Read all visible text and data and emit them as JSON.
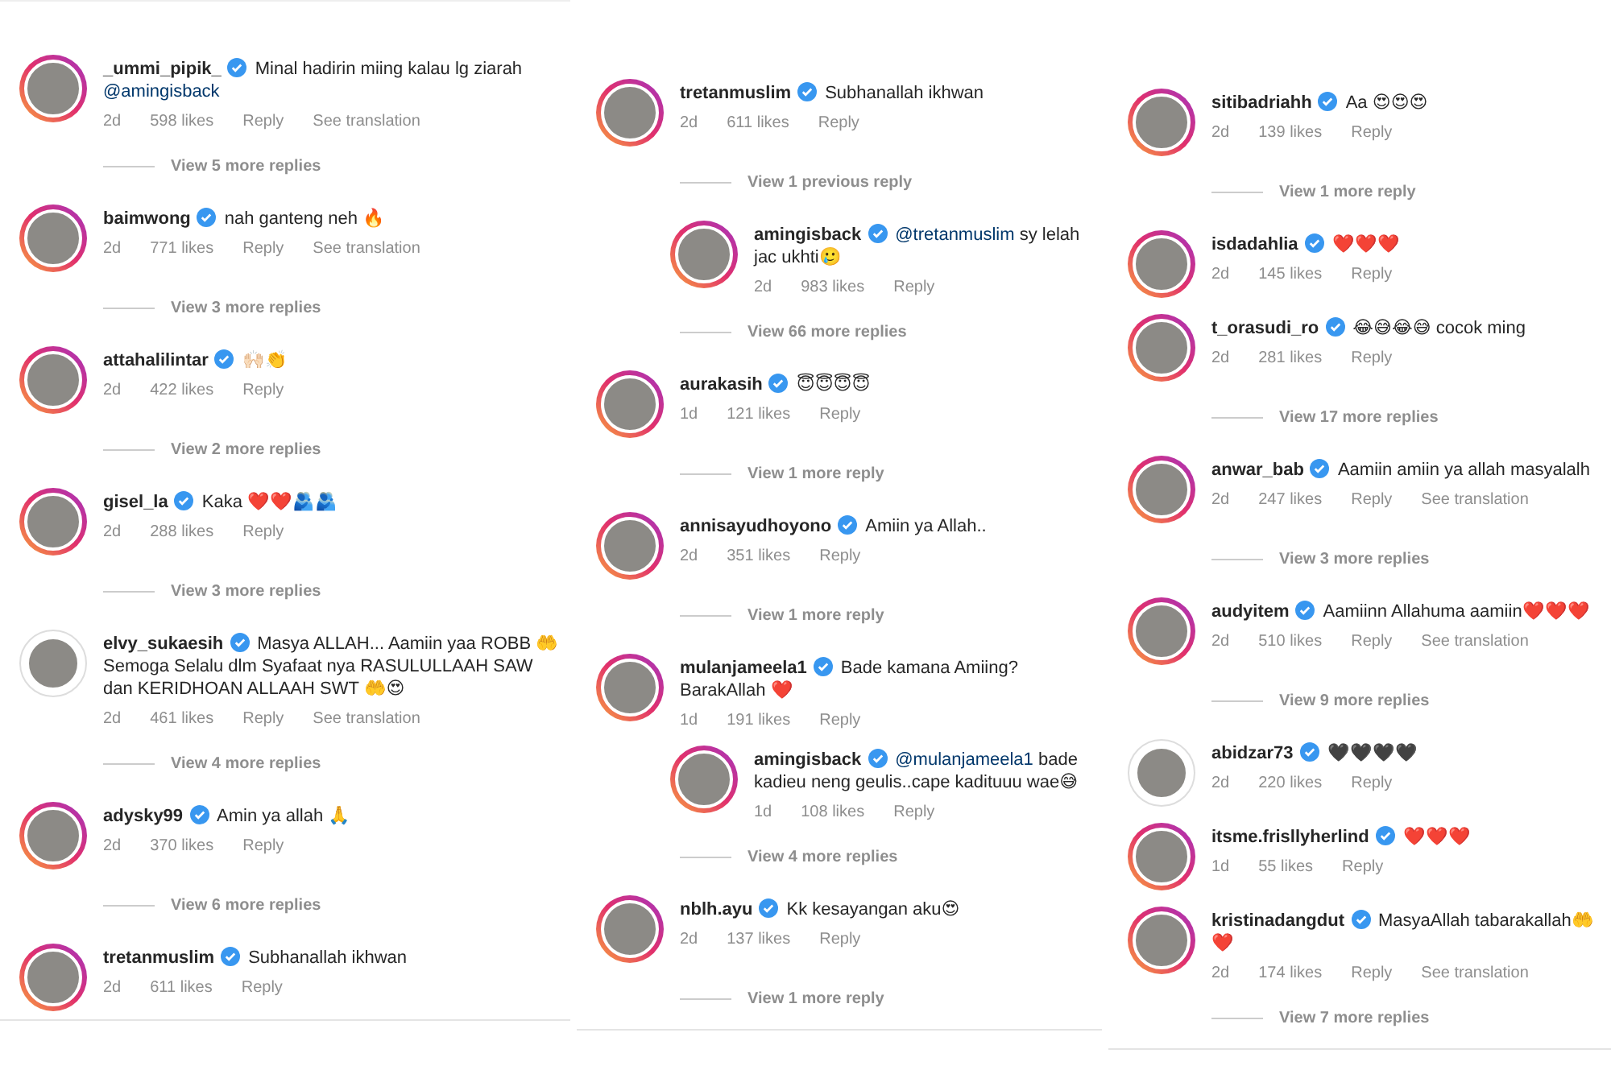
{
  "columns": [
    {
      "items": [
        {
          "kind": "comment",
          "username": "_ummi_pipik_",
          "verified": true,
          "story_ring": true,
          "parts": [
            {
              "kind": "text",
              "s": "Minal hadirin miing kalau lg ziarah "
            },
            {
              "kind": "mention",
              "s": "@amingisback"
            }
          ],
          "time": "2d",
          "likes": "598 likes",
          "reply": "Reply",
          "translation": "See translation"
        },
        {
          "kind": "view_replies",
          "label": "View 5 more replies"
        },
        {
          "kind": "comment",
          "username": "baimwong",
          "verified": true,
          "story_ring": true,
          "parts": [
            {
              "kind": "text",
              "s": "nah ganteng neh 🔥"
            }
          ],
          "time": "2d",
          "likes": "771 likes",
          "reply": "Reply",
          "translation": "See translation"
        },
        {
          "kind": "view_replies",
          "label": "View 3 more replies"
        },
        {
          "kind": "comment",
          "username": "attahalilintar",
          "verified": true,
          "story_ring": true,
          "parts": [
            {
              "kind": "text",
              "s": "🙌🏻👏"
            }
          ],
          "time": "2d",
          "likes": "422 likes",
          "reply": "Reply"
        },
        {
          "kind": "view_replies",
          "label": "View 2 more replies"
        },
        {
          "kind": "comment",
          "username": "gisel_la",
          "verified": true,
          "story_ring": true,
          "parts": [
            {
              "kind": "text",
              "s": "Kaka ❤️❤️🫂🫂"
            }
          ],
          "time": "2d",
          "likes": "288 likes",
          "reply": "Reply"
        },
        {
          "kind": "view_replies",
          "label": "View 3 more replies"
        },
        {
          "kind": "comment",
          "username": "elvy_sukaesih",
          "verified": true,
          "story_ring": false,
          "parts": [
            {
              "kind": "text",
              "s": "Masya ALLAH... Aamiin yaa ROBB 🤲 Semoga Selalu dlm Syafaat nya RASULULLAAH SAW dan KERIDHOAN ALLAAH SWT 🤲😍"
            }
          ],
          "time": "2d",
          "likes": "461 likes",
          "reply": "Reply",
          "translation": "See translation"
        },
        {
          "kind": "view_replies",
          "label": "View 4 more replies"
        },
        {
          "kind": "comment",
          "username": "adysky99",
          "verified": true,
          "story_ring": true,
          "parts": [
            {
              "kind": "text",
              "s": "Amin ya allah 🙏"
            }
          ],
          "time": "2d",
          "likes": "370 likes",
          "reply": "Reply"
        },
        {
          "kind": "view_replies",
          "label": "View 6 more replies"
        },
        {
          "kind": "comment",
          "username": "tretanmuslim",
          "verified": true,
          "story_ring": true,
          "parts": [
            {
              "kind": "text",
              "s": "Subhanallah ikhwan"
            }
          ],
          "time": "2d",
          "likes": "611 likes",
          "reply": "Reply"
        }
      ]
    },
    {
      "items": [
        {
          "kind": "comment",
          "username": "tretanmuslim",
          "verified": true,
          "story_ring": true,
          "parts": [
            {
              "kind": "text",
              "s": "Subhanallah ikhwan"
            }
          ],
          "time": "2d",
          "likes": "611 likes",
          "reply": "Reply",
          "children": [
            {
              "kind": "view_replies",
              "label": "View 1 previous reply"
            },
            {
              "kind": "comment",
              "username": "amingisback",
              "verified": true,
              "story_ring": true,
              "parts": [
                {
                  "kind": "mention",
                  "s": "@tretanmuslim"
                },
                {
                  "kind": "text",
                  "s": " sy lelah jac ukhti🥲"
                }
              ],
              "time": "2d",
              "likes": "983 likes",
              "reply": "Reply"
            }
          ]
        },
        {
          "kind": "view_replies",
          "label": "View 66 more replies"
        },
        {
          "kind": "comment",
          "username": "aurakasih",
          "verified": true,
          "story_ring": true,
          "parts": [
            {
              "kind": "text",
              "s": "😇😇😇😇"
            }
          ],
          "time": "1d",
          "likes": "121 likes",
          "reply": "Reply"
        },
        {
          "kind": "view_replies",
          "label": "View 1 more reply"
        },
        {
          "kind": "comment",
          "username": "annisayudhoyono",
          "verified": true,
          "story_ring": true,
          "parts": [
            {
              "kind": "text",
              "s": "Amiin ya Allah.."
            }
          ],
          "time": "2d",
          "likes": "351 likes",
          "reply": "Reply"
        },
        {
          "kind": "view_replies",
          "label": "View 1 more reply"
        },
        {
          "kind": "comment",
          "username": "mulanjameela1",
          "verified": true,
          "story_ring": true,
          "parts": [
            {
              "kind": "text",
              "s": "Bade kamana Amiing? BarakAllah ❤️"
            }
          ],
          "time": "1d",
          "likes": "191 likes",
          "reply": "Reply",
          "children": [
            {
              "kind": "comment",
              "username": "amingisback",
              "verified": true,
              "story_ring": true,
              "parts": [
                {
                  "kind": "mention",
                  "s": "@mulanjameela1"
                },
                {
                  "kind": "text",
                  "s": " bade kadieu neng geulis..cape kadituuu wae😅"
                }
              ],
              "time": "1d",
              "likes": "108 likes",
              "reply": "Reply"
            }
          ]
        },
        {
          "kind": "view_replies",
          "label": "View 4 more replies"
        },
        {
          "kind": "comment",
          "username": "nblh.ayu",
          "verified": true,
          "story_ring": true,
          "parts": [
            {
              "kind": "text",
              "s": "Kk kesayangan aku😍"
            }
          ],
          "time": "2d",
          "likes": "137 likes",
          "reply": "Reply"
        },
        {
          "kind": "view_replies",
          "label": "View 1 more reply"
        }
      ]
    },
    {
      "items": [
        {
          "kind": "comment",
          "username": "sitibadriahh",
          "verified": true,
          "story_ring": true,
          "parts": [
            {
              "kind": "text",
              "s": "Aa 😍😍😍"
            }
          ],
          "time": "2d",
          "likes": "139 likes",
          "reply": "Reply"
        },
        {
          "kind": "view_replies",
          "label": "View 1 more reply"
        },
        {
          "kind": "comment",
          "username": "isdadahlia",
          "verified": true,
          "story_ring": true,
          "parts": [
            {
              "kind": "text",
              "s": "❤️❤️❤️"
            }
          ],
          "time": "2d",
          "likes": "145 likes",
          "reply": "Reply"
        },
        {
          "kind": "comment",
          "username": "t_orasudi_ro",
          "verified": true,
          "story_ring": true,
          "parts": [
            {
              "kind": "text",
              "s": "😂😅😂😅 cocok ming"
            }
          ],
          "time": "2d",
          "likes": "281 likes",
          "reply": "Reply"
        },
        {
          "kind": "view_replies",
          "label": "View 17 more replies"
        },
        {
          "kind": "comment",
          "username": "anwar_bab",
          "verified": true,
          "story_ring": true,
          "parts": [
            {
              "kind": "text",
              "s": "Aamiin amiin ya allah masyalalh"
            }
          ],
          "time": "2d",
          "likes": "247 likes",
          "reply": "Reply",
          "translation": "See translation"
        },
        {
          "kind": "view_replies",
          "label": "View 3 more replies"
        },
        {
          "kind": "comment",
          "username": "audyitem",
          "verified": true,
          "story_ring": true,
          "parts": [
            {
              "kind": "text",
              "s": "Aamiinn Allahuma aamiin❤️❤️❤️"
            }
          ],
          "time": "2d",
          "likes": "510 likes",
          "reply": "Reply",
          "translation": "See translation"
        },
        {
          "kind": "view_replies",
          "label": "View 9 more replies"
        },
        {
          "kind": "comment",
          "username": "abidzar73",
          "verified": true,
          "story_ring": false,
          "parts": [
            {
              "kind": "text",
              "s": "🖤🖤🖤🖤"
            }
          ],
          "time": "2d",
          "likes": "220 likes",
          "reply": "Reply"
        },
        {
          "kind": "comment",
          "username": "itsme.frisllyherlind",
          "verified": true,
          "story_ring": true,
          "parts": [
            {
              "kind": "text",
              "s": "❤️❤️❤️"
            }
          ],
          "time": "1d",
          "likes": "55 likes",
          "reply": "Reply"
        },
        {
          "kind": "comment",
          "username": "kristinadangdut",
          "verified": true,
          "story_ring": true,
          "parts": [
            {
              "kind": "text",
              "s": "MasyaAllah tabarakallah🤲❤️"
            }
          ],
          "time": "2d",
          "likes": "174 likes",
          "reply": "Reply",
          "translation": "See translation"
        },
        {
          "kind": "view_replies",
          "label": "View 7 more replies"
        }
      ]
    }
  ]
}
